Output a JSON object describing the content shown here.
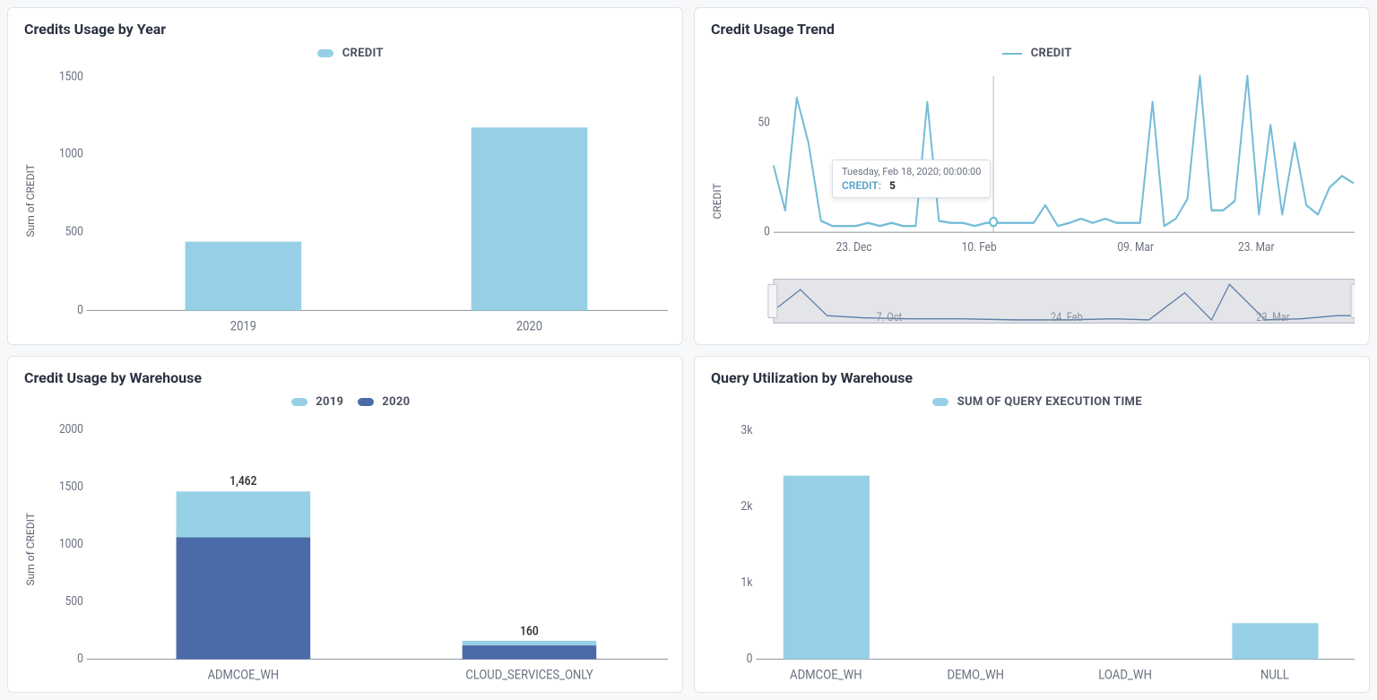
{
  "colors": {
    "light": "#97d0e6",
    "dark": "#4b6aa8",
    "line": "#74bcd8"
  },
  "panel1": {
    "title": "Credits Usage by Year",
    "legend": "CREDIT",
    "ylabel": "Sum of CREDIT",
    "ticks": [
      "0",
      "500",
      "1000",
      "1500"
    ],
    "cats": [
      "2019",
      "2020"
    ]
  },
  "panel2": {
    "title": "Credit Usage Trend",
    "legend": "CREDIT",
    "ylabel": "CREDIT",
    "ticks": [
      "0",
      "50"
    ],
    "xticks": [
      "23. Dec",
      "10. Feb",
      "09. Mar",
      "23. Mar"
    ],
    "range_ticks": [
      "7. Oct",
      "24. Feb",
      "23. Mar"
    ],
    "tooltip": {
      "date": "Tuesday, Feb 18, 2020; 00:00:00",
      "series": "CREDIT:",
      "value": "5"
    }
  },
  "panel3": {
    "title": "Credit Usage by Warehouse",
    "legend_a": "2019",
    "legend_b": "2020",
    "ylabel": "Sum of CREDIT",
    "ticks": [
      "0",
      "500",
      "1000",
      "1500",
      "2000"
    ],
    "cats": [
      "ADMCOE_WH",
      "CLOUD_SERVICES_ONLY"
    ],
    "labels": [
      "1,462",
      "160"
    ]
  },
  "panel4": {
    "title": "Query Utilization by Warehouse",
    "legend": "SUM OF QUERY EXECUTION TIME",
    "ticks": [
      "0",
      "1k",
      "2k",
      "3k"
    ],
    "cats": [
      "ADMCOE_WH",
      "DEMO_WH",
      "LOAD_WH",
      "NULL"
    ]
  },
  "chart_data": [
    {
      "id": "credits_usage_by_year",
      "type": "bar",
      "title": "Credits Usage by Year",
      "ylabel": "Sum of CREDIT",
      "categories": [
        "2019",
        "2020"
      ],
      "series": [
        {
          "name": "CREDIT",
          "values": [
            440,
            1170
          ]
        }
      ],
      "ylim": [
        0,
        1500
      ]
    },
    {
      "id": "credit_usage_trend",
      "type": "line",
      "title": "Credit Usage Trend",
      "ylabel": "CREDIT",
      "x_tick_labels": [
        "23. Dec",
        "10. Feb",
        "09. Mar",
        "23. Mar"
      ],
      "ylim": [
        0,
        70
      ],
      "series": [
        {
          "name": "CREDIT",
          "values": [
            30,
            10,
            60,
            40,
            5,
            3,
            3,
            3,
            4,
            3,
            4,
            3,
            3,
            58,
            5,
            4,
            4,
            3,
            4,
            4,
            4,
            4,
            4,
            12,
            3,
            4,
            6,
            4,
            6,
            4,
            4,
            4,
            58,
            3,
            6,
            15,
            70,
            10,
            10,
            14,
            70,
            8,
            48,
            8,
            40,
            12,
            8,
            20,
            25,
            22
          ]
        }
      ],
      "tooltip_point": {
        "x_label": "Tuesday, Feb 18, 2020; 00:00:00",
        "series": "CREDIT",
        "value": 5
      },
      "navigator_range_labels": [
        "7. Oct",
        "24. Feb",
        "23. Mar"
      ]
    },
    {
      "id": "credit_usage_by_warehouse",
      "type": "bar_stacked",
      "title": "Credit Usage by Warehouse",
      "ylabel": "Sum of CREDIT",
      "categories": [
        "ADMCOE_WH",
        "CLOUD_SERVICES_ONLY"
      ],
      "series": [
        {
          "name": "2019",
          "values": [
            400,
            40
          ]
        },
        {
          "name": "2020",
          "values": [
            1062,
            120
          ]
        }
      ],
      "totals": [
        1462,
        160
      ],
      "ylim": [
        0,
        2000
      ]
    },
    {
      "id": "query_utilization_by_warehouse",
      "type": "bar",
      "title": "Query Utilization by Warehouse",
      "categories": [
        "ADMCOE_WH",
        "DEMO_WH",
        "LOAD_WH",
        "NULL"
      ],
      "series": [
        {
          "name": "SUM OF QUERY EXECUTION TIME",
          "values": [
            2400,
            0,
            0,
            470
          ]
        }
      ],
      "ylim": [
        0,
        3000
      ]
    }
  ]
}
